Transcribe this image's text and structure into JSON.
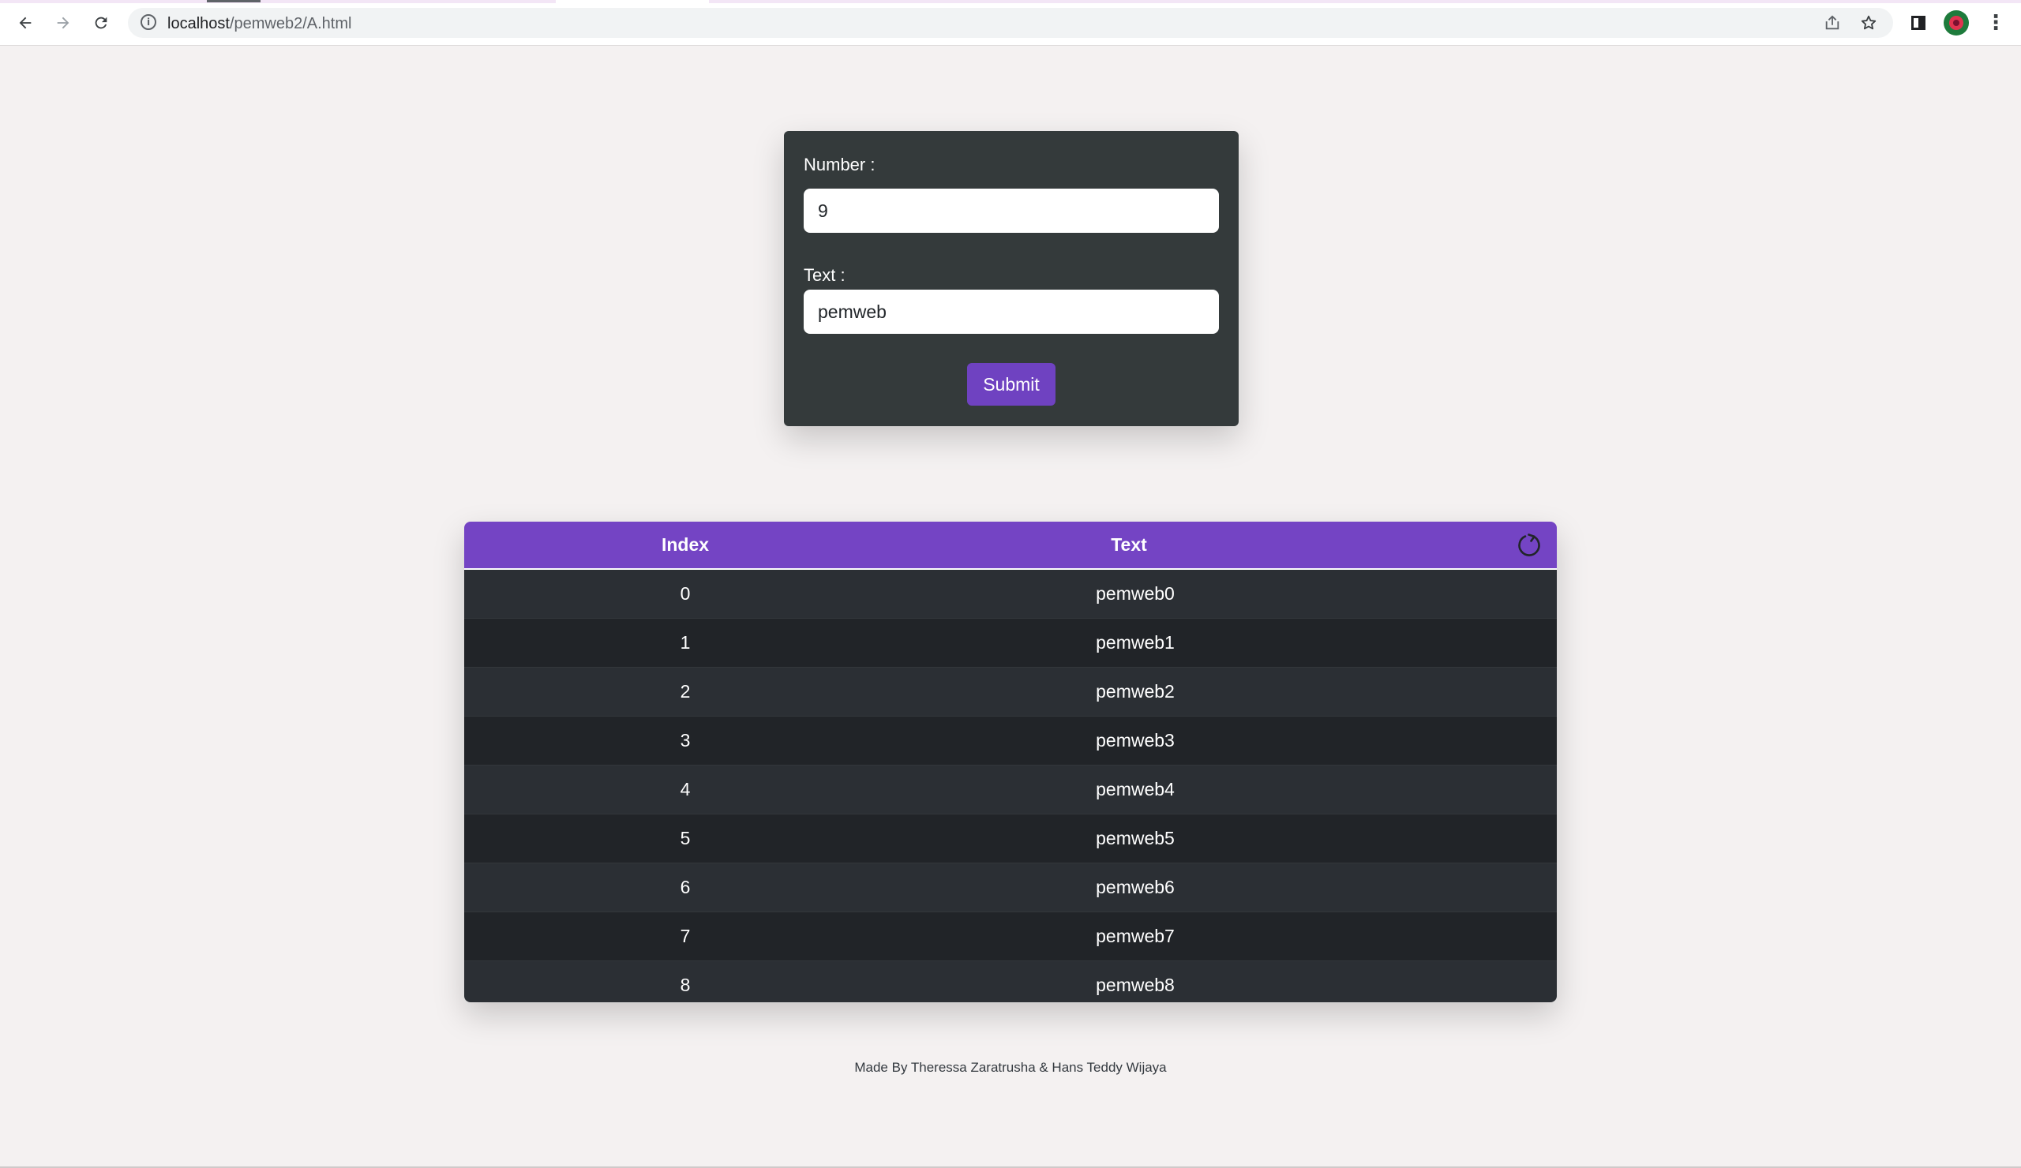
{
  "browser": {
    "url_host": "localhost",
    "url_path": "/pemweb2/A.html"
  },
  "form": {
    "number_label": "Number :",
    "number_value": "9",
    "text_label": "Text :",
    "text_value": "pemweb",
    "submit_label": "Submit"
  },
  "table": {
    "headers": {
      "index": "Index",
      "text": "Text"
    },
    "rows": [
      {
        "index": "0",
        "text": "pemweb0"
      },
      {
        "index": "1",
        "text": "pemweb1"
      },
      {
        "index": "2",
        "text": "pemweb2"
      },
      {
        "index": "3",
        "text": "pemweb3"
      },
      {
        "index": "4",
        "text": "pemweb4"
      },
      {
        "index": "5",
        "text": "pemweb5"
      },
      {
        "index": "6",
        "text": "pemweb6"
      },
      {
        "index": "7",
        "text": "pemweb7"
      },
      {
        "index": "8",
        "text": "pemweb8"
      }
    ]
  },
  "footer": {
    "credit": "Made By Theressa Zaratrusha & Hans Teddy Wijaya"
  },
  "colors": {
    "accent": "#7444c4",
    "button": "#6f42c1",
    "card": "#343a3b",
    "page_bg": "#f4f1f1"
  },
  "icons": [
    "back-icon",
    "forward-icon",
    "reload-icon",
    "info-icon",
    "share-icon",
    "bookmark-star-icon",
    "side-panel-icon",
    "profile-avatar",
    "more-menu-icon",
    "refresh-icon"
  ]
}
